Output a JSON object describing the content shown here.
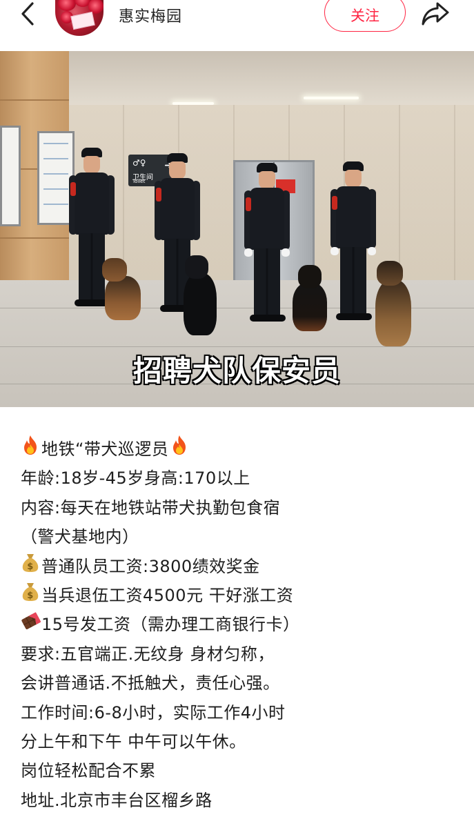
{
  "header": {
    "author_name": "惠实梅园",
    "follow_label": "关注"
  },
  "icons": {
    "back": "chevron-left-icon",
    "share": "share-arrow-icon",
    "fire": "fire-icon",
    "money_bag": "money-bag-icon",
    "chocolate": "chocolate-bar-icon"
  },
  "colors": {
    "accent": "#ff2442",
    "text": "#1e1e1e"
  },
  "photo": {
    "caption": "招聘犬队保安员",
    "toilet_sign_text": "卫生间",
    "toilet_sign_sub": "Toilet"
  },
  "post": {
    "lines": [
      {
        "icon": "fire",
        "text": "地铁“带犬巡逻员",
        "trail_icon": "fire"
      },
      {
        "icon": "",
        "text": "年龄:18岁-45岁身高:170以上",
        "trail_icon": ""
      },
      {
        "icon": "",
        "text": "内容:每天在地铁站带犬执勤包食宿",
        "trail_icon": ""
      },
      {
        "icon": "",
        "text": "（警犬基地内）",
        "trail_icon": ""
      },
      {
        "icon": "money_bag",
        "text": "普通队员工资:3800绩效奖金",
        "trail_icon": ""
      },
      {
        "icon": "money_bag",
        "text": "当兵退伍工资4500元 干好涨工资",
        "trail_icon": ""
      },
      {
        "icon": "chocolate",
        "text": "15号发工资（需办理工商银行卡）",
        "trail_icon": ""
      },
      {
        "icon": "",
        "text": "要求:五官端正.无纹身 身材匀称，",
        "trail_icon": ""
      },
      {
        "icon": "",
        "text": "会讲普通话.不抵触犬，责任心强。",
        "trail_icon": ""
      },
      {
        "icon": "",
        "text": "工作时间:6-8小时，实际工作4小时",
        "trail_icon": ""
      },
      {
        "icon": "",
        "text": "分上午和下午 中午可以午休。",
        "trail_icon": ""
      },
      {
        "icon": "",
        "text": "岗位轻松配合不累",
        "trail_icon": ""
      },
      {
        "icon": "",
        "text": "地址.北京市丰台区榴乡路",
        "trail_icon": ""
      }
    ]
  }
}
